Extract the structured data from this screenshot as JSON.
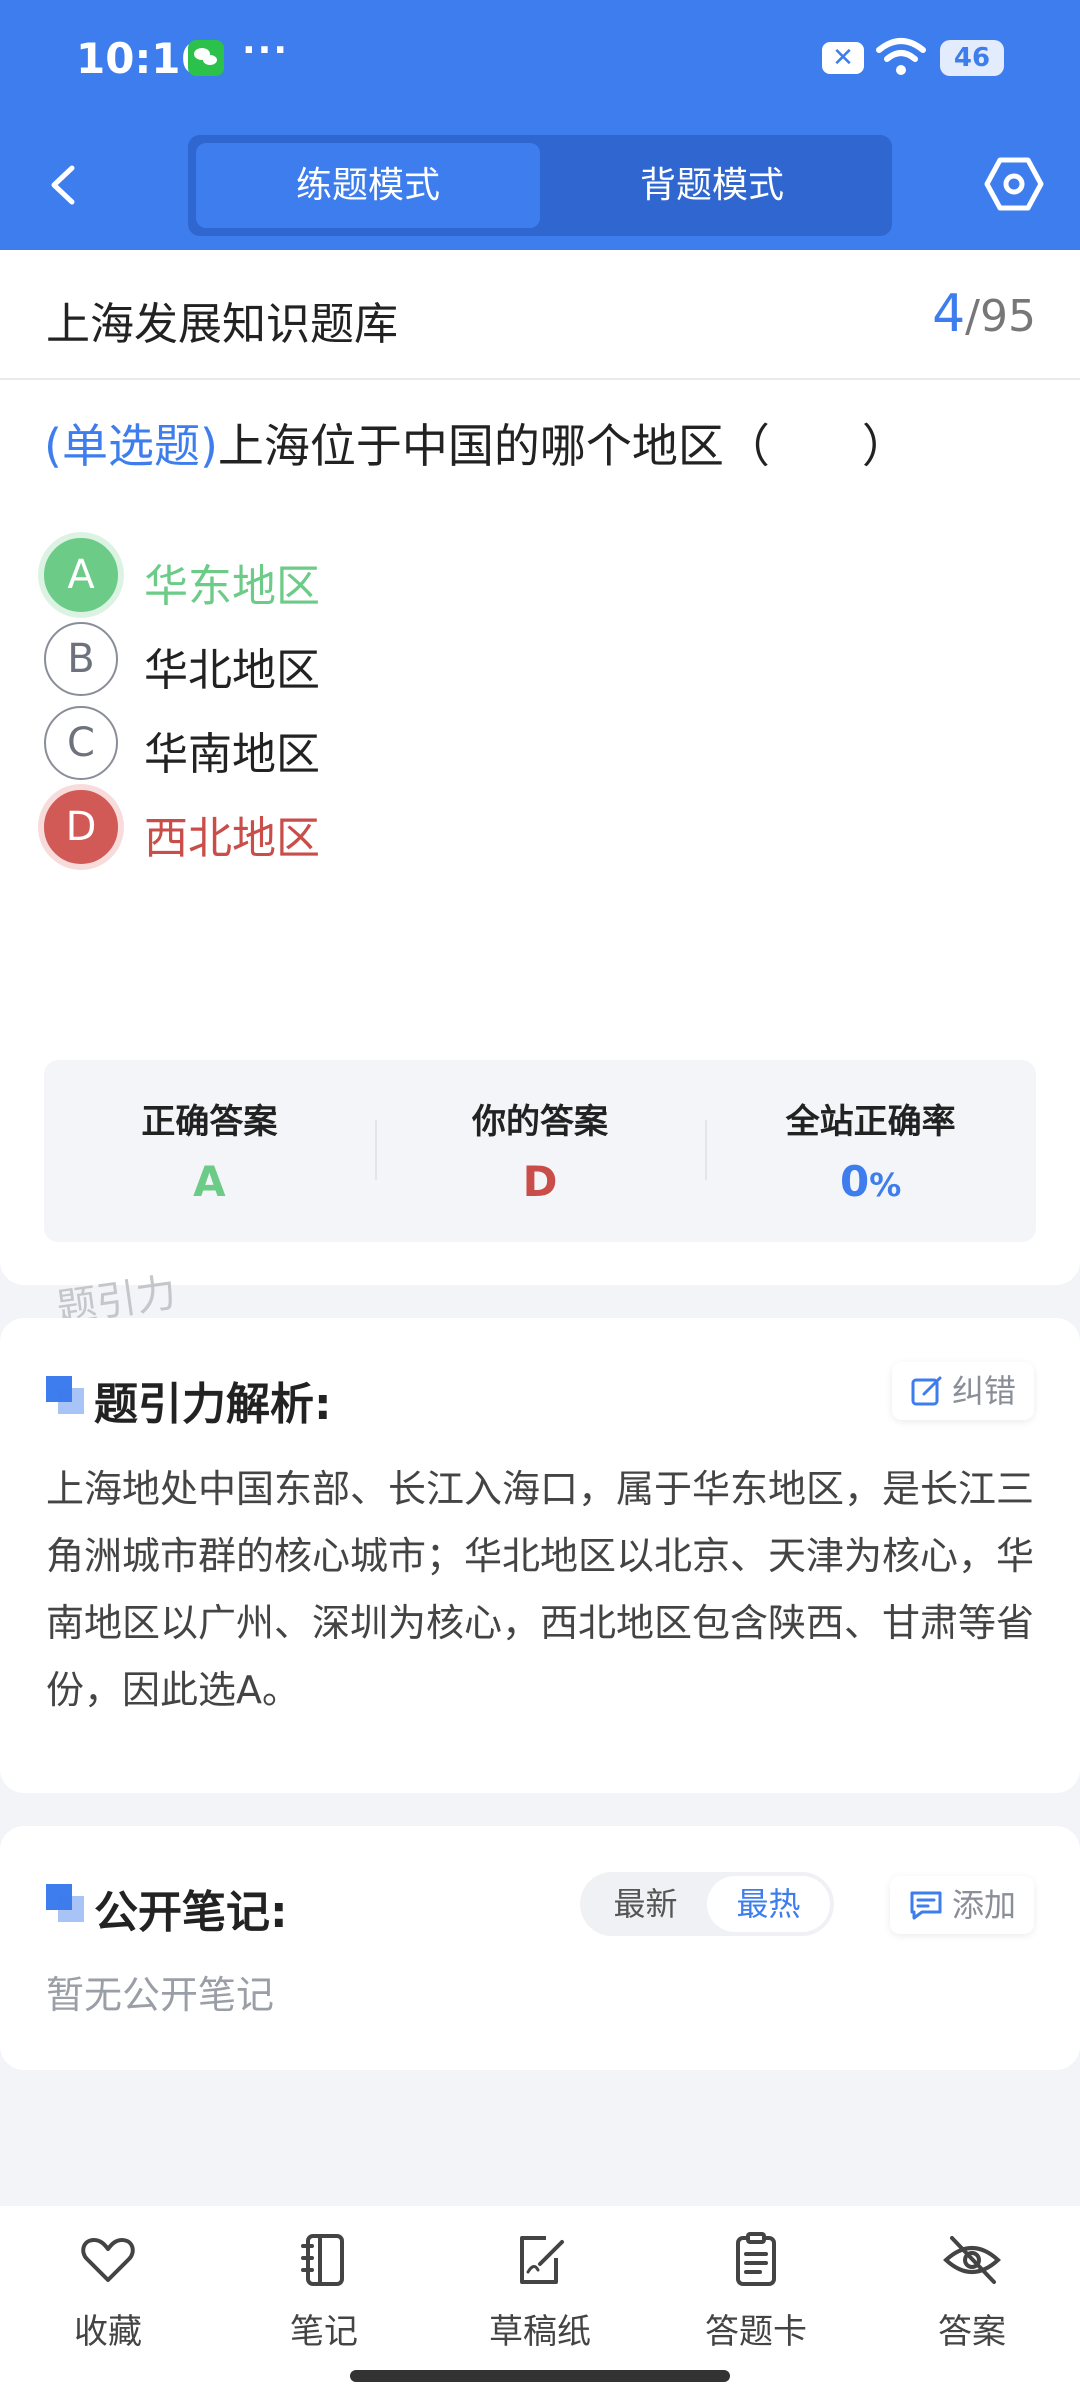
{
  "status_bar": {
    "time": "10:16",
    "more": "···",
    "battery": "46"
  },
  "header": {
    "tabs": [
      {
        "label": "练题模式",
        "active": true
      },
      {
        "label": "背题模式",
        "active": false
      }
    ],
    "icons": [
      "back-arrow-icon",
      "settings-hexagon-icon"
    ]
  },
  "bank": {
    "title": "上海发展知识题库",
    "current": "4",
    "separator": "/",
    "total": "95"
  },
  "question": {
    "type": "(单选题)",
    "text": "上海位于中国的哪个地区（　　）"
  },
  "options": [
    {
      "letter": "A",
      "text": "华东地区",
      "state": "correct"
    },
    {
      "letter": "B",
      "text": "华北地区",
      "state": "normal"
    },
    {
      "letter": "C",
      "text": "华南地区",
      "state": "normal"
    },
    {
      "letter": "D",
      "text": "西北地区",
      "state": "wrong"
    }
  ],
  "stats": {
    "correct_label": "正确答案",
    "correct_value": "A",
    "yours_label": "你的答案",
    "yours_value": "D",
    "rate_label": "全站正确率",
    "rate_value": "0",
    "rate_unit": "%"
  },
  "watermark": "题引力",
  "analysis": {
    "title": "题引力解析:",
    "report_label": "纠错",
    "text": "上海地处中国东部、长江入海口，属于华东地区，是长江三角洲城市群的核心城市；华北地区以北京、天津为核心，华南地区以广州、深圳为核心，西北地区包含陕西、甘肃等省份，因此选A。"
  },
  "notes": {
    "title": "公开笔记:",
    "sort_options": [
      {
        "label": "最新",
        "active": false
      },
      {
        "label": "最热",
        "active": true
      }
    ],
    "add_label": "添加",
    "empty_text": "暂无公开笔记"
  },
  "bottom_bar": [
    {
      "label": "收藏",
      "icon": "heart-icon"
    },
    {
      "label": "笔记",
      "icon": "notebook-icon"
    },
    {
      "label": "草稿纸",
      "icon": "draft-paper-icon"
    },
    {
      "label": "答题卡",
      "icon": "answer-sheet-icon"
    },
    {
      "label": "答案",
      "icon": "eye-off-icon"
    }
  ],
  "colors": {
    "primary": "#3e7ded",
    "correct": "#6bcb87",
    "wrong": "#d25a56"
  }
}
